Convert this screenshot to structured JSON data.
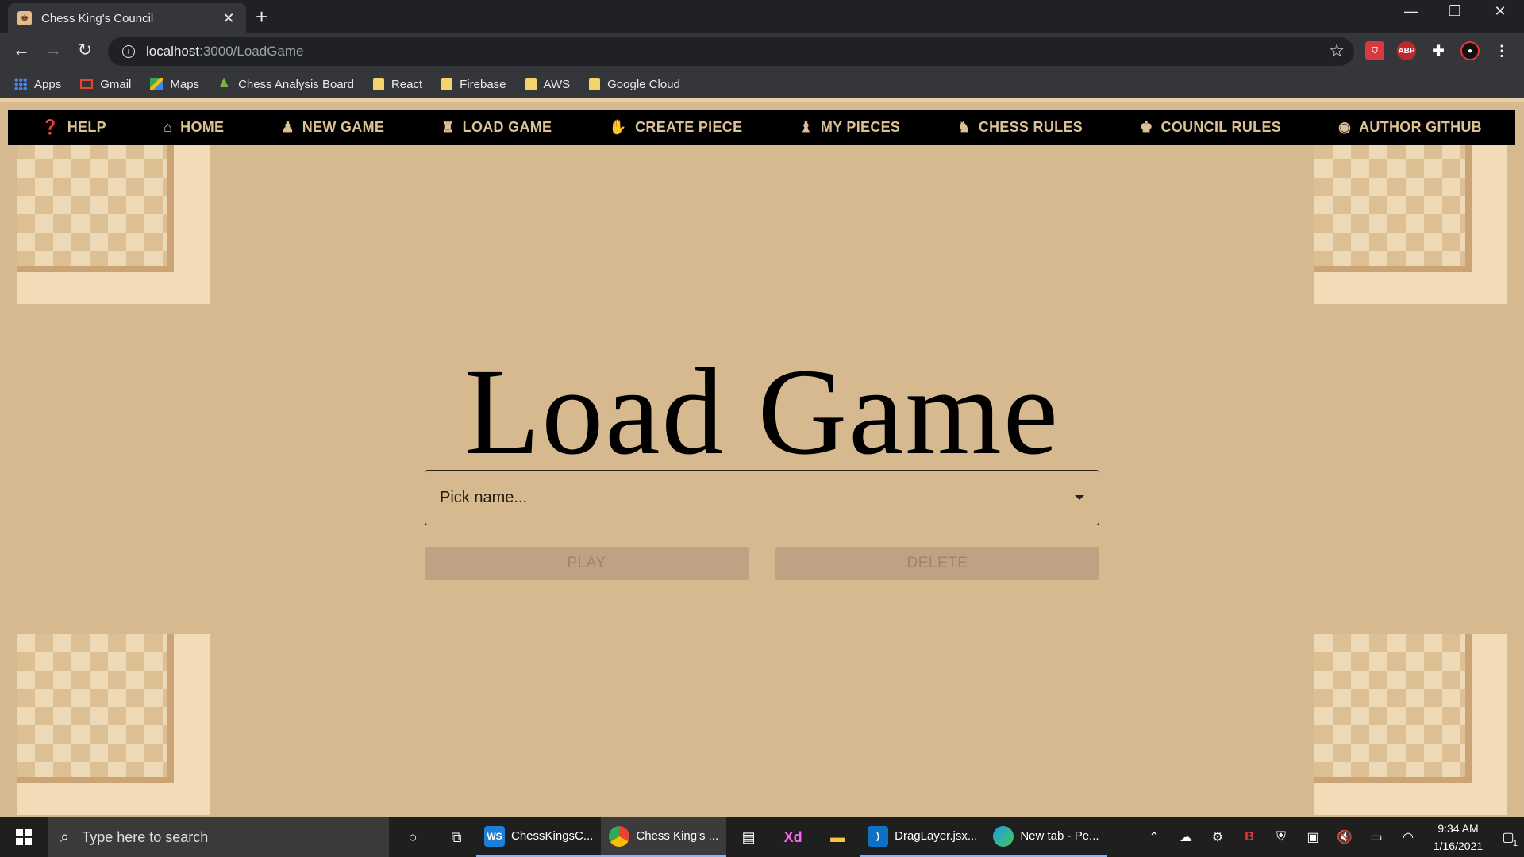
{
  "browser": {
    "tab_title": "Chess King's Council",
    "url_host": "localhost",
    "url_path": ":3000/LoadGame",
    "bookmarks": [
      {
        "label": "Apps",
        "icon": "apps-grid-icon"
      },
      {
        "label": "Gmail",
        "icon": "gmail-icon"
      },
      {
        "label": "Maps",
        "icon": "maps-icon"
      },
      {
        "label": "Chess Analysis Board",
        "icon": "chess-pawn-icon"
      },
      {
        "label": "React",
        "icon": "folder-icon"
      },
      {
        "label": "Firebase",
        "icon": "folder-icon"
      },
      {
        "label": "AWS",
        "icon": "folder-icon"
      },
      {
        "label": "Google Cloud",
        "icon": "folder-icon"
      }
    ]
  },
  "app": {
    "nav": [
      {
        "label": "HELP",
        "icon": "question-circle-icon"
      },
      {
        "label": "HOME",
        "icon": "home-icon"
      },
      {
        "label": "NEW GAME",
        "icon": "chess-pawn-icon"
      },
      {
        "label": "LOAD GAME",
        "icon": "chess-rook-icon"
      },
      {
        "label": "CREATE PIECE",
        "icon": "hand-icon"
      },
      {
        "label": "MY PIECES",
        "icon": "chess-bishop-icon"
      },
      {
        "label": "CHESS RULES",
        "icon": "chess-knight-icon"
      },
      {
        "label": "COUNCIL RULES",
        "icon": "chess-king-icon"
      },
      {
        "label": "AUTHOR GITHUB",
        "icon": "github-icon"
      }
    ],
    "title": "Load Game",
    "select_placeholder": "Pick name...",
    "play_label": "PLAY",
    "delete_label": "DELETE"
  },
  "taskbar": {
    "search_placeholder": "Type here to search",
    "apps": [
      {
        "label": "ChessKingsC...",
        "icon": "webstorm-icon"
      },
      {
        "label": "Chess King's ...",
        "icon": "chrome-icon"
      },
      {
        "label": "DragLayer.jsx...",
        "icon": "vscode-icon"
      },
      {
        "label": "New tab - Pe...",
        "icon": "edge-icon"
      }
    ],
    "time": "9:34 AM",
    "date": "1/16/2021",
    "notification_count": "1"
  }
}
